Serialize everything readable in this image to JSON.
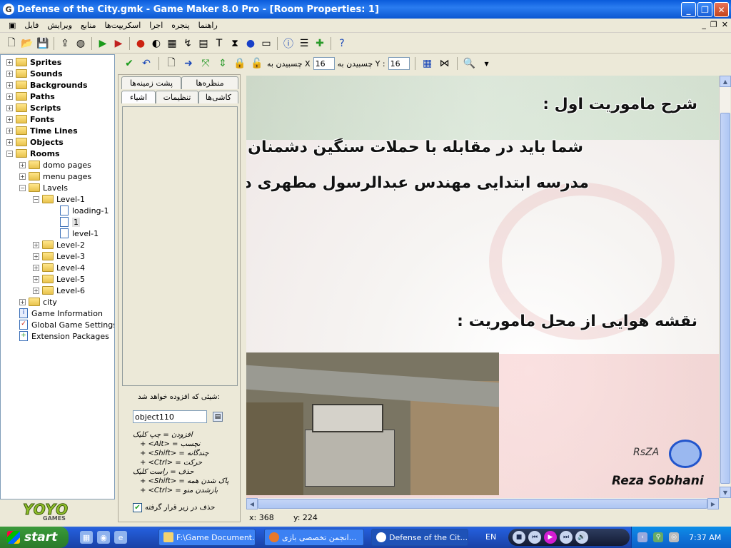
{
  "window": {
    "title": "Defense of the City.gmk - Game Maker 8.0 Pro - [Room Properties: 1]"
  },
  "menubar": {
    "items": [
      "فایل",
      "ویرایش",
      "منابع",
      "اسکریپت‌ها",
      "اجرا",
      "پنجره",
      "راهنما"
    ]
  },
  "tree": {
    "items": [
      {
        "label": "Sprites"
      },
      {
        "label": "Sounds"
      },
      {
        "label": "Backgrounds"
      },
      {
        "label": "Paths"
      },
      {
        "label": "Scripts"
      },
      {
        "label": "Fonts"
      },
      {
        "label": "Time Lines"
      },
      {
        "label": "Objects"
      },
      {
        "label": "Rooms"
      },
      {
        "label": "domo pages"
      },
      {
        "label": "menu pages"
      },
      {
        "label": "Lavels"
      },
      {
        "label": "Level-1"
      },
      {
        "label": "loading-1"
      },
      {
        "label": "1"
      },
      {
        "label": "level-1"
      },
      {
        "label": "Level-2"
      },
      {
        "label": "Level-3"
      },
      {
        "label": "Level-4"
      },
      {
        "label": "Level-5"
      },
      {
        "label": "Level-6"
      },
      {
        "label": "city"
      },
      {
        "label": "Game Information"
      },
      {
        "label": "Global Game Settings"
      },
      {
        "label": "Extension Packages"
      }
    ]
  },
  "branding": {
    "logo": "YOYO",
    "sub": "GAMES"
  },
  "room_toolbar": {
    "snap_x_label": "چسبیدن به X",
    "snap_x_value": "16",
    "snap_y_label": "چسبیدن به Y :",
    "snap_y_value": "16"
  },
  "tabs": {
    "row1": [
      "پشت زمینه‌ها",
      "منظره‌ها"
    ],
    "row2": [
      "اشیاء",
      "تنظیمات",
      "کاشی‌ها"
    ]
  },
  "object_panel": {
    "title": "شیئی که افزوده خواهد شد:",
    "selected": "object110",
    "help": [
      "افزودن = چپ کلیک",
      "+ <Alt> = نچسب",
      "+ <Shift> = چندگانه",
      "+ <Ctrl> = حرکت",
      "حذف = راست کلیک",
      "+ <Shift> = پاک شدن همه",
      "+ <Ctrl> = بازشدن منو"
    ],
    "delete_underlying": "حذف در زیر قرار گرفته",
    "delete_checked": true
  },
  "canvas": {
    "line1": "شرح ماموریت اول :",
    "line2": "شما باید در مقابله با حملات سنگین دشمنان",
    "line3": "مدرسه ابتدایی مهندس عبدالرسول مطهری د",
    "line4": "نقشه هوایی از محل ماموریت :",
    "logo_name": "Reza Sobhani",
    "logo_sig": "RsZA"
  },
  "status": {
    "x": "x: 368",
    "y": "y: 224"
  },
  "taskbar": {
    "start": "start",
    "tasks": [
      "F:\\Game Document...",
      "انجمن تخصصی بازی...",
      "Defense of the Cit..."
    ],
    "lang": "EN",
    "clock": "7:37 AM"
  }
}
